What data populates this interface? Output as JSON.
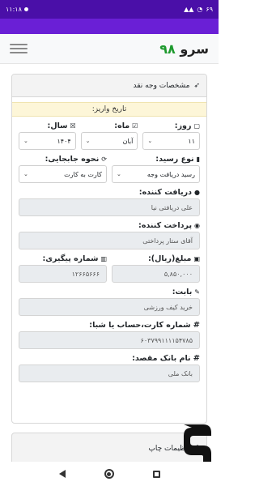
{
  "status_bar": {
    "time": "۱۱:۱۸",
    "battery": "۶۹",
    "colors": {
      "bar": "#4a0fa8"
    }
  },
  "app": {
    "brand_number": "۹۸",
    "brand_text": "سرو",
    "accent": "#6a1fd6",
    "brand_green": "#1e9a2e"
  },
  "card": {
    "header_icon": "rocket-icon",
    "header_title": "مشخصات وجه نقد",
    "date_label": "تاریخ واریز:",
    "day": {
      "label": "روز:",
      "value": "۱۱"
    },
    "month": {
      "label": "ماه:",
      "value": "آبان"
    },
    "year": {
      "label": "سال:",
      "value": "۱۴۰۴"
    },
    "receipt_type": {
      "label": "نوع رسید:",
      "value": "رسید دریافت وجه"
    },
    "transfer_method": {
      "label": "نحوه جابجایی:",
      "value": "کارت به کارت"
    },
    "receiver": {
      "label": "دریافت کننده:",
      "value": "علی دریافتی نیا"
    },
    "payer": {
      "label": "پرداخت کننده:",
      "value": "آقای ستار پرداختی"
    },
    "amount": {
      "label": "مبلغ(ریال):",
      "value": "۵,۸۵۰,۰۰۰"
    },
    "tracking": {
      "label": "شماره پیگیری:",
      "value": "۱۲۶۶۵۶۶۶"
    },
    "for": {
      "label": "بابت:",
      "value": "خرید کیف ورزشی"
    },
    "card_number": {
      "label": "شماره کارت،حساب یا شبا:",
      "value": "۶۰۳۷۹۹۱۱۱۱۵۴۷۸۵"
    },
    "dest_bank": {
      "label": "نام بانک مقصد:",
      "value": "بانک ملی"
    }
  },
  "print_settings": {
    "title": "تنظیمات چاپ",
    "icon": "print-icon"
  }
}
